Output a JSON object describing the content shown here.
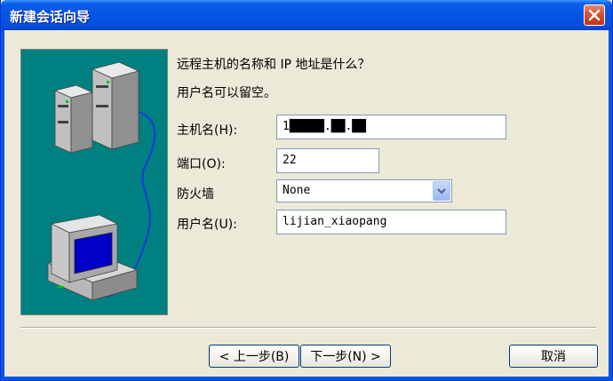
{
  "window": {
    "title": "新建会话向导"
  },
  "question": {
    "line1": "远程主机的名称和 IP 地址是什么？",
    "line2": "用户名可以留空。"
  },
  "form": {
    "host_label": "主机名(H):",
    "host_value": "1█████.██.██",
    "port_label": "端口(O):",
    "port_value": "22",
    "firewall_label": "防火墙",
    "firewall_value": "None",
    "user_label": "用户名(U):",
    "user_value": "lijian_xiaopang"
  },
  "buttons": {
    "prev": "< 上一步(B)",
    "next": "下一步(N) >",
    "cancel": "取消"
  },
  "icons": {
    "close": "close-icon",
    "dropdown": "chevron-down-icon",
    "illustration": "network-computers-illustration"
  },
  "colors": {
    "titlebar": "#0554e3",
    "illustration_bg": "#008080",
    "dialog_bg": "#ece9d8",
    "close_button": "#d8553a"
  }
}
